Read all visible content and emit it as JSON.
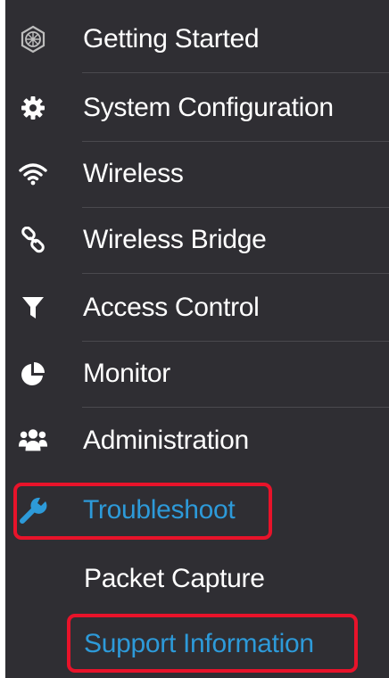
{
  "nav": {
    "items": [
      {
        "label": "Getting Started",
        "icon": "globe-icon"
      },
      {
        "label": "System Configuration",
        "icon": "gear-icon"
      },
      {
        "label": "Wireless",
        "icon": "wifi-icon"
      },
      {
        "label": "Wireless Bridge",
        "icon": "link-icon"
      },
      {
        "label": "Access Control",
        "icon": "filter-icon"
      },
      {
        "label": "Monitor",
        "icon": "pie-chart-icon"
      },
      {
        "label": "Administration",
        "icon": "users-icon"
      },
      {
        "label": "Troubleshoot",
        "icon": "wrench-icon"
      }
    ],
    "subitems": [
      {
        "label": "Packet Capture"
      },
      {
        "label": "Support Information"
      }
    ]
  },
  "colors": {
    "panel_bg": "#2f2e33",
    "text": "#ffffff",
    "active_text": "#2d9ad9",
    "highlight_border": "#e8132a"
  }
}
